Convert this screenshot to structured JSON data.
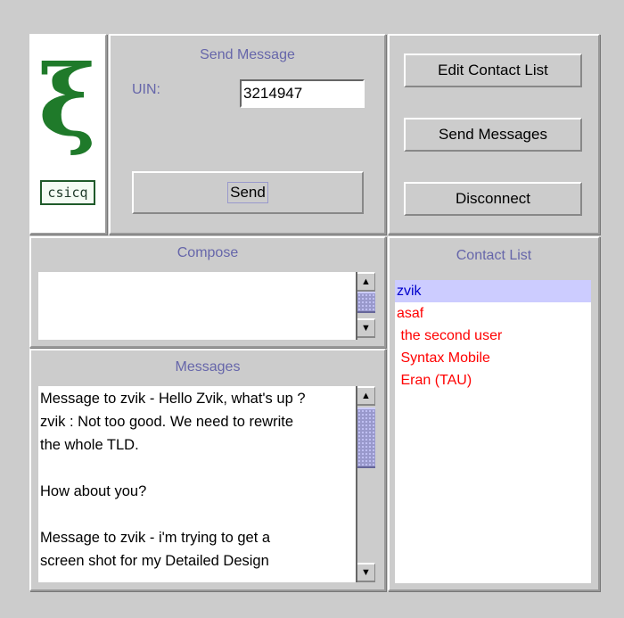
{
  "logo": {
    "glyph": "ξ",
    "label": "csicq"
  },
  "send_message": {
    "title": "Send Message",
    "uin_label": "UIN:",
    "uin_value": "3214947",
    "send_button": "Send"
  },
  "actions": {
    "edit_contact_list": "Edit Contact List",
    "send_messages": "Send Messages",
    "disconnect": "Disconnect"
  },
  "compose": {
    "title": "Compose",
    "text": ""
  },
  "messages": {
    "title": "Messages",
    "lines": [
      "Message to zvik  - Hello Zvik, what's up ?",
      "zvik : Not too good. We need to rewrite",
      "the whole TLD.",
      "",
      "How about you?",
      "",
      "Message to zvik  - i'm trying to get a",
      "screen shot for my Detailed Design"
    ]
  },
  "contact_list": {
    "title": "Contact List",
    "contacts": [
      {
        "name": "zvik",
        "selected": true
      },
      {
        "name": "asaf",
        "selected": false
      },
      {
        "name": " the second user",
        "selected": false
      },
      {
        "name": " Syntax Mobile",
        "selected": false
      },
      {
        "name": " Eran (TAU)",
        "selected": false
      }
    ]
  },
  "colors": {
    "title_text": "#6666aa",
    "contact_online": "#ff0000",
    "contact_selected_bg": "#ccccff",
    "contact_selected_text": "#0000cc",
    "logo_green": "#1f7a2a"
  }
}
